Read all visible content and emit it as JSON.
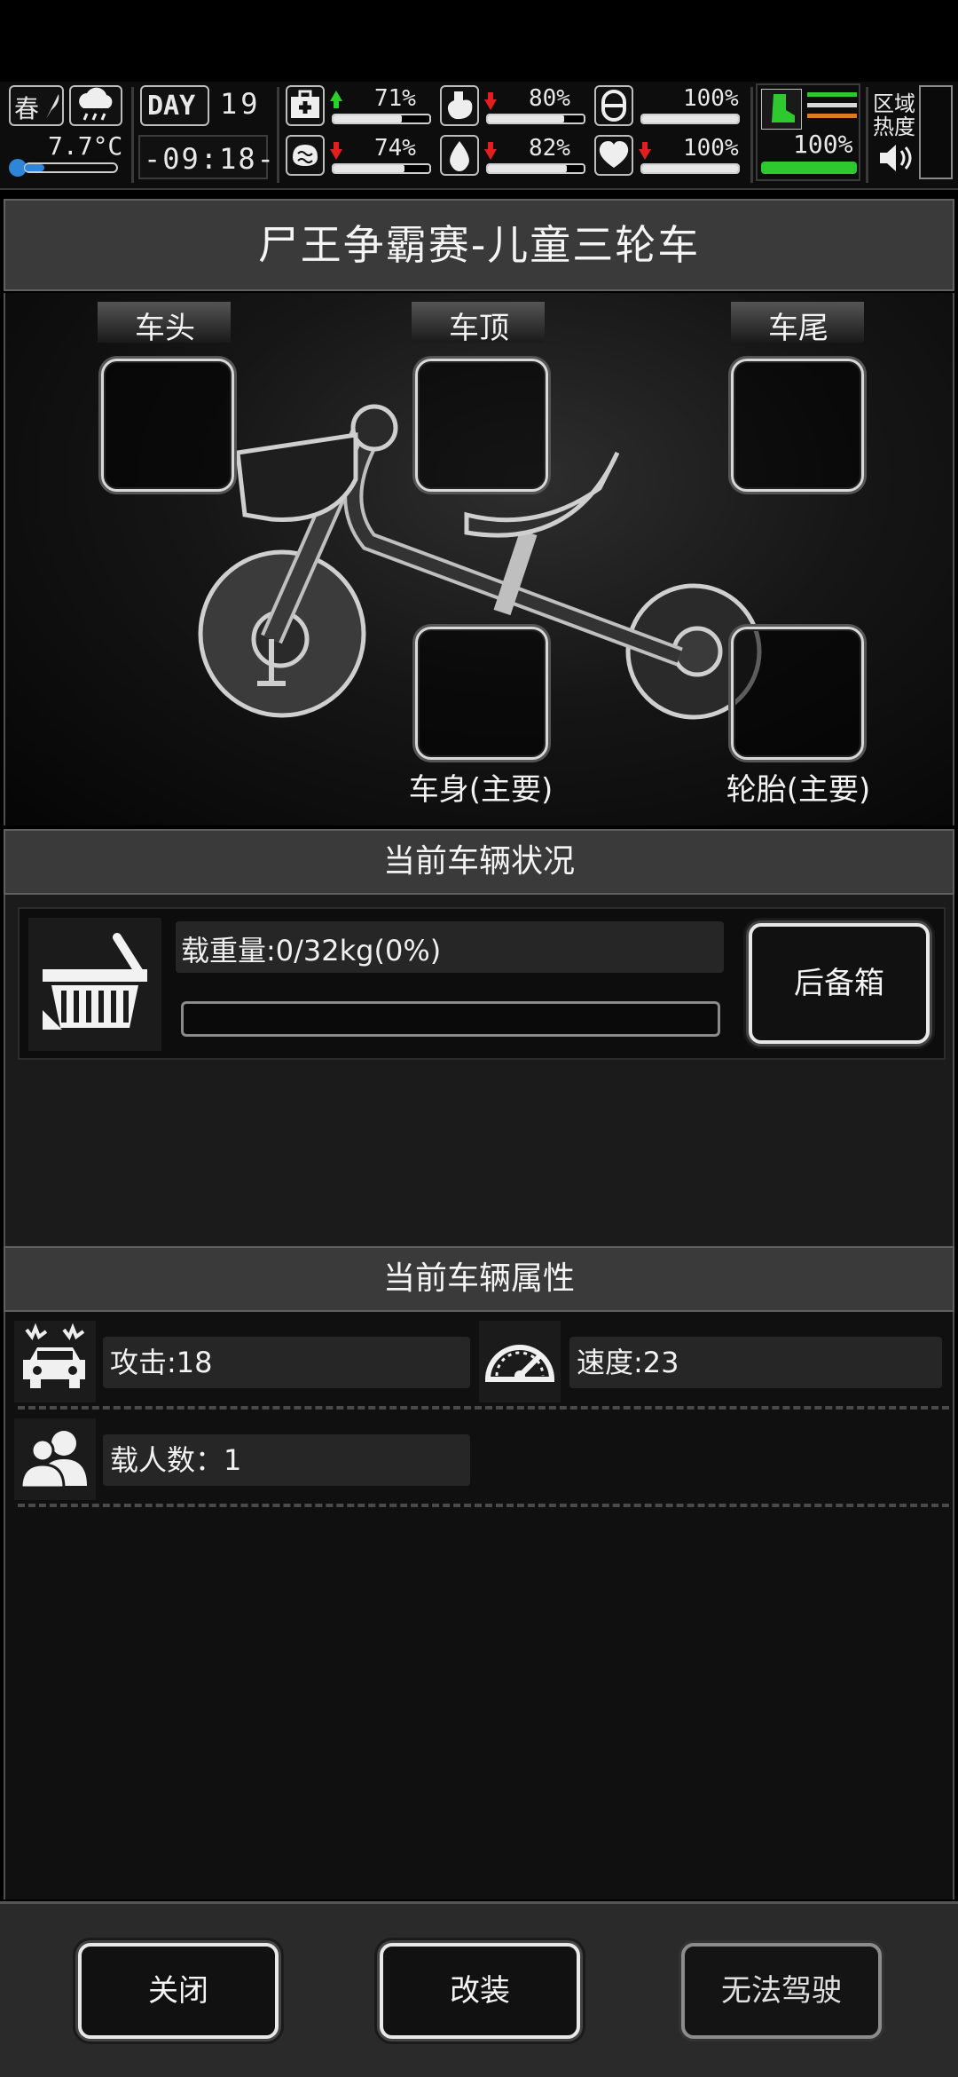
{
  "hud": {
    "season": "春",
    "temperature": "7.7°C",
    "day_label": "DAY",
    "day_number": "19",
    "clock": "-09:18-",
    "stats": [
      {
        "icon": "medkit-icon",
        "trend": "up",
        "value": "71%",
        "level": 0.71
      },
      {
        "icon": "stomach-icon",
        "trend": "down",
        "value": "80%",
        "level": 0.8
      },
      {
        "icon": "pill-icon",
        "trend": "none",
        "value": "100%",
        "level": 1.0
      },
      {
        "icon": "brain-icon",
        "trend": "down",
        "value": "74%",
        "level": 0.74
      },
      {
        "icon": "water-drop-icon",
        "trend": "down",
        "value": "82%",
        "level": 0.82
      },
      {
        "icon": "heart-icon",
        "trend": "down",
        "value": "100%",
        "level": 1.0
      }
    ],
    "stamina": "100%",
    "stamina_level": 1.0,
    "zone_heat_label": "区域\n热度",
    "colors": {
      "up": "#2bd12b",
      "down": "#e02020",
      "stamina": "#2ec92e",
      "orange": "#e07a1f"
    }
  },
  "vehicle": {
    "title": "尸王争霸赛-儿童三轮车",
    "slots": {
      "head": "车头",
      "roof": "车顶",
      "tail": "车尾",
      "body": "车身(主要)",
      "tire": "轮胎(主要)"
    }
  },
  "status": {
    "header": "当前车辆状况",
    "load_text": "载重量:0/32kg(0%)",
    "load_level": 0,
    "trunk_button": "后备箱"
  },
  "attributes": {
    "header": "当前车辆属性",
    "attack": "攻击:18",
    "speed": "速度:23",
    "passengers": "载人数：1"
  },
  "footer": {
    "close": "关闭",
    "modify": "改装",
    "drive": "无法驾驶"
  }
}
